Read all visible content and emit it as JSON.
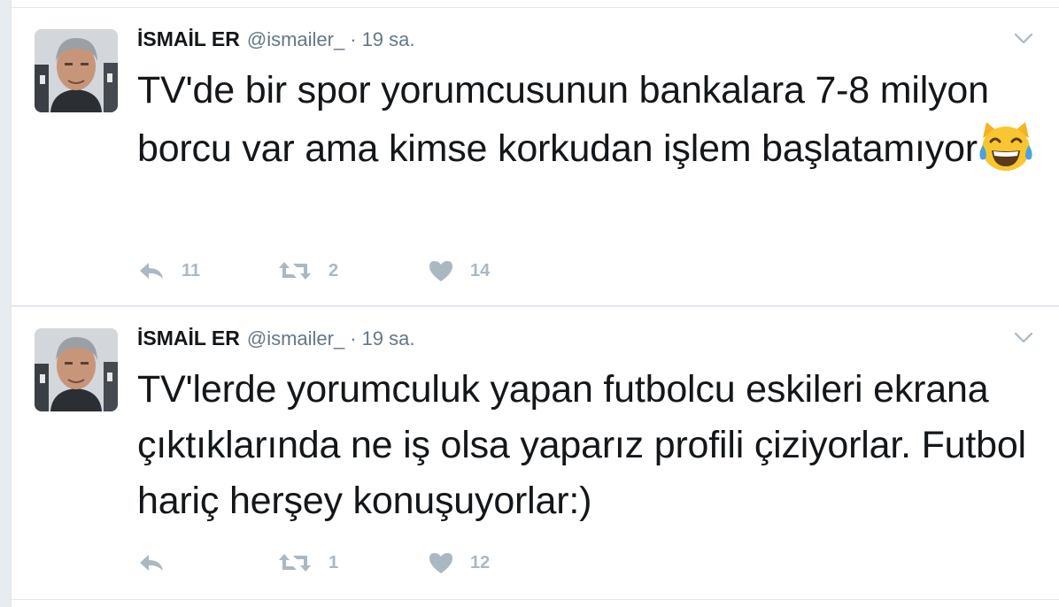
{
  "tweets": [
    {
      "author": {
        "name": "İSMAİL ER",
        "handle": "@ismailer_"
      },
      "separator": "·",
      "time": "19 sa.",
      "text": "TV'de bir spor yorumcusunun bankalara 7-8 milyon borcu var ama kimse korkudan işlem başlatamıyor",
      "emoji": "face-with-tears-of-joy",
      "replies": "11",
      "retweets": "2",
      "likes": "14"
    },
    {
      "author": {
        "name": "İSMAİL ER",
        "handle": "@ismailer_"
      },
      "separator": "·",
      "time": "19 sa.",
      "text": "TV'lerde yorumculuk yapan futbolcu eskileri ekrana çıktıklarında ne iş olsa yaparız profili çiziyorlar. Futbol hariç herşey konuşuyorlar:)",
      "replies": "",
      "retweets": "1",
      "likes": "12"
    }
  ],
  "icons": {
    "reply": "reply-icon",
    "retweet": "retweet-icon",
    "like": "heart-icon",
    "menu": "chevron-down-icon"
  },
  "colors": {
    "action_gray": "#aab8c2",
    "meta_gray": "#657786",
    "text": "#14171a",
    "border": "#e1e8ed"
  }
}
